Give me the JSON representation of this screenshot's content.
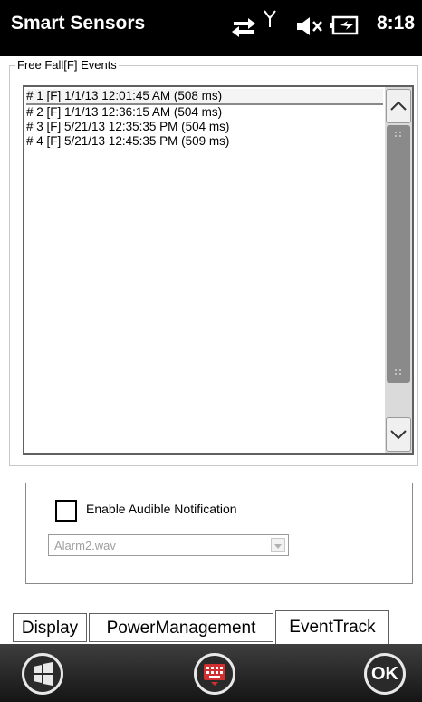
{
  "status_bar": {
    "app_title": "Smart Sensors",
    "time": "8:18",
    "icons": [
      "data-transfer-icon",
      "signal-antenna-icon",
      "speaker-muted-icon",
      "battery-charging-icon"
    ]
  },
  "events_group": {
    "label": "Free Fall[F] Events",
    "items": [
      "# 1 [F] 1/1/13 12:01:45 AM (508 ms)",
      "# 2 [F] 1/1/13 12:36:15 AM (504 ms)",
      "# 3 [F] 5/21/13 12:35:35 PM (504 ms)",
      "# 4 [F] 5/21/13 12:45:35 PM (509 ms)"
    ]
  },
  "notification": {
    "checkbox_label": "Enable Audible Notification",
    "checked": false,
    "sound_value": "Alarm2.wav"
  },
  "tabs": [
    {
      "label": "Display"
    },
    {
      "label": "PowerManagement"
    },
    {
      "label": "EventTrack"
    }
  ],
  "active_tab": "EventTrack",
  "nav": {
    "ok_label": "OK"
  },
  "colors": {
    "status_bar_bg": "#000000",
    "scrollbar_thumb": "#8a8a8a",
    "keyboard_icon_red": "#d03030"
  }
}
